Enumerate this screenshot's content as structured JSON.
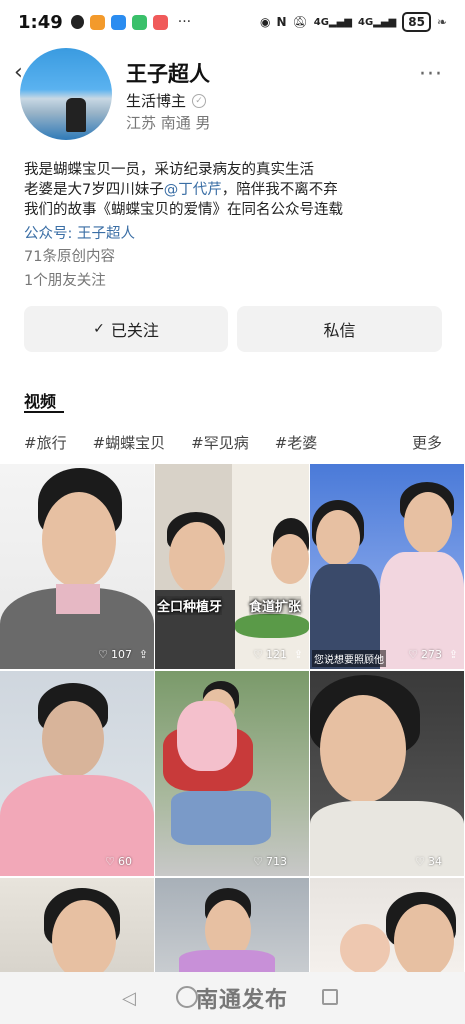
{
  "status": {
    "time": "1:49",
    "network1": "4G",
    "network2": "4G",
    "battery": "85"
  },
  "profile": {
    "name": "王子超人",
    "role": "生活博主",
    "location": "江苏 南通 男",
    "bio_line1": "我是蝴蝶宝贝一员，采访纪录病友的真实生活",
    "bio_line2_a": "老婆是大7岁四川妹子",
    "bio_line2_mention": "@丁代芹",
    "bio_line2_b": "，陪伴我不离不弃",
    "bio_line3": "我们的故事《蝴蝶宝贝的爱情》在同名公众号连载",
    "public_account": "公众号: 王子超人",
    "original_count": "71条原创内容",
    "friends_follow": "1个朋友关注"
  },
  "actions": {
    "follow_label": "已关注",
    "message_label": "私信"
  },
  "tabs": {
    "video": "视频"
  },
  "tags": {
    "items": [
      "#旅行",
      "#蝴蝶宝贝",
      "#罕见病",
      "#老婆"
    ],
    "more": "更多"
  },
  "videos": [
    {
      "likes": "107"
    },
    {
      "likes": "121",
      "caption_left": "全口种植牙",
      "caption_right": "食道扩张"
    },
    {
      "likes": "273",
      "subtitle": "您说想要照顾他"
    },
    {
      "likes": "60"
    },
    {
      "likes": "713"
    },
    {
      "likes": "34"
    }
  ],
  "nav": {
    "watermark": "南通发布"
  },
  "colors": {
    "link": "#3a6ea5",
    "button_bg": "#f2f2f2"
  }
}
